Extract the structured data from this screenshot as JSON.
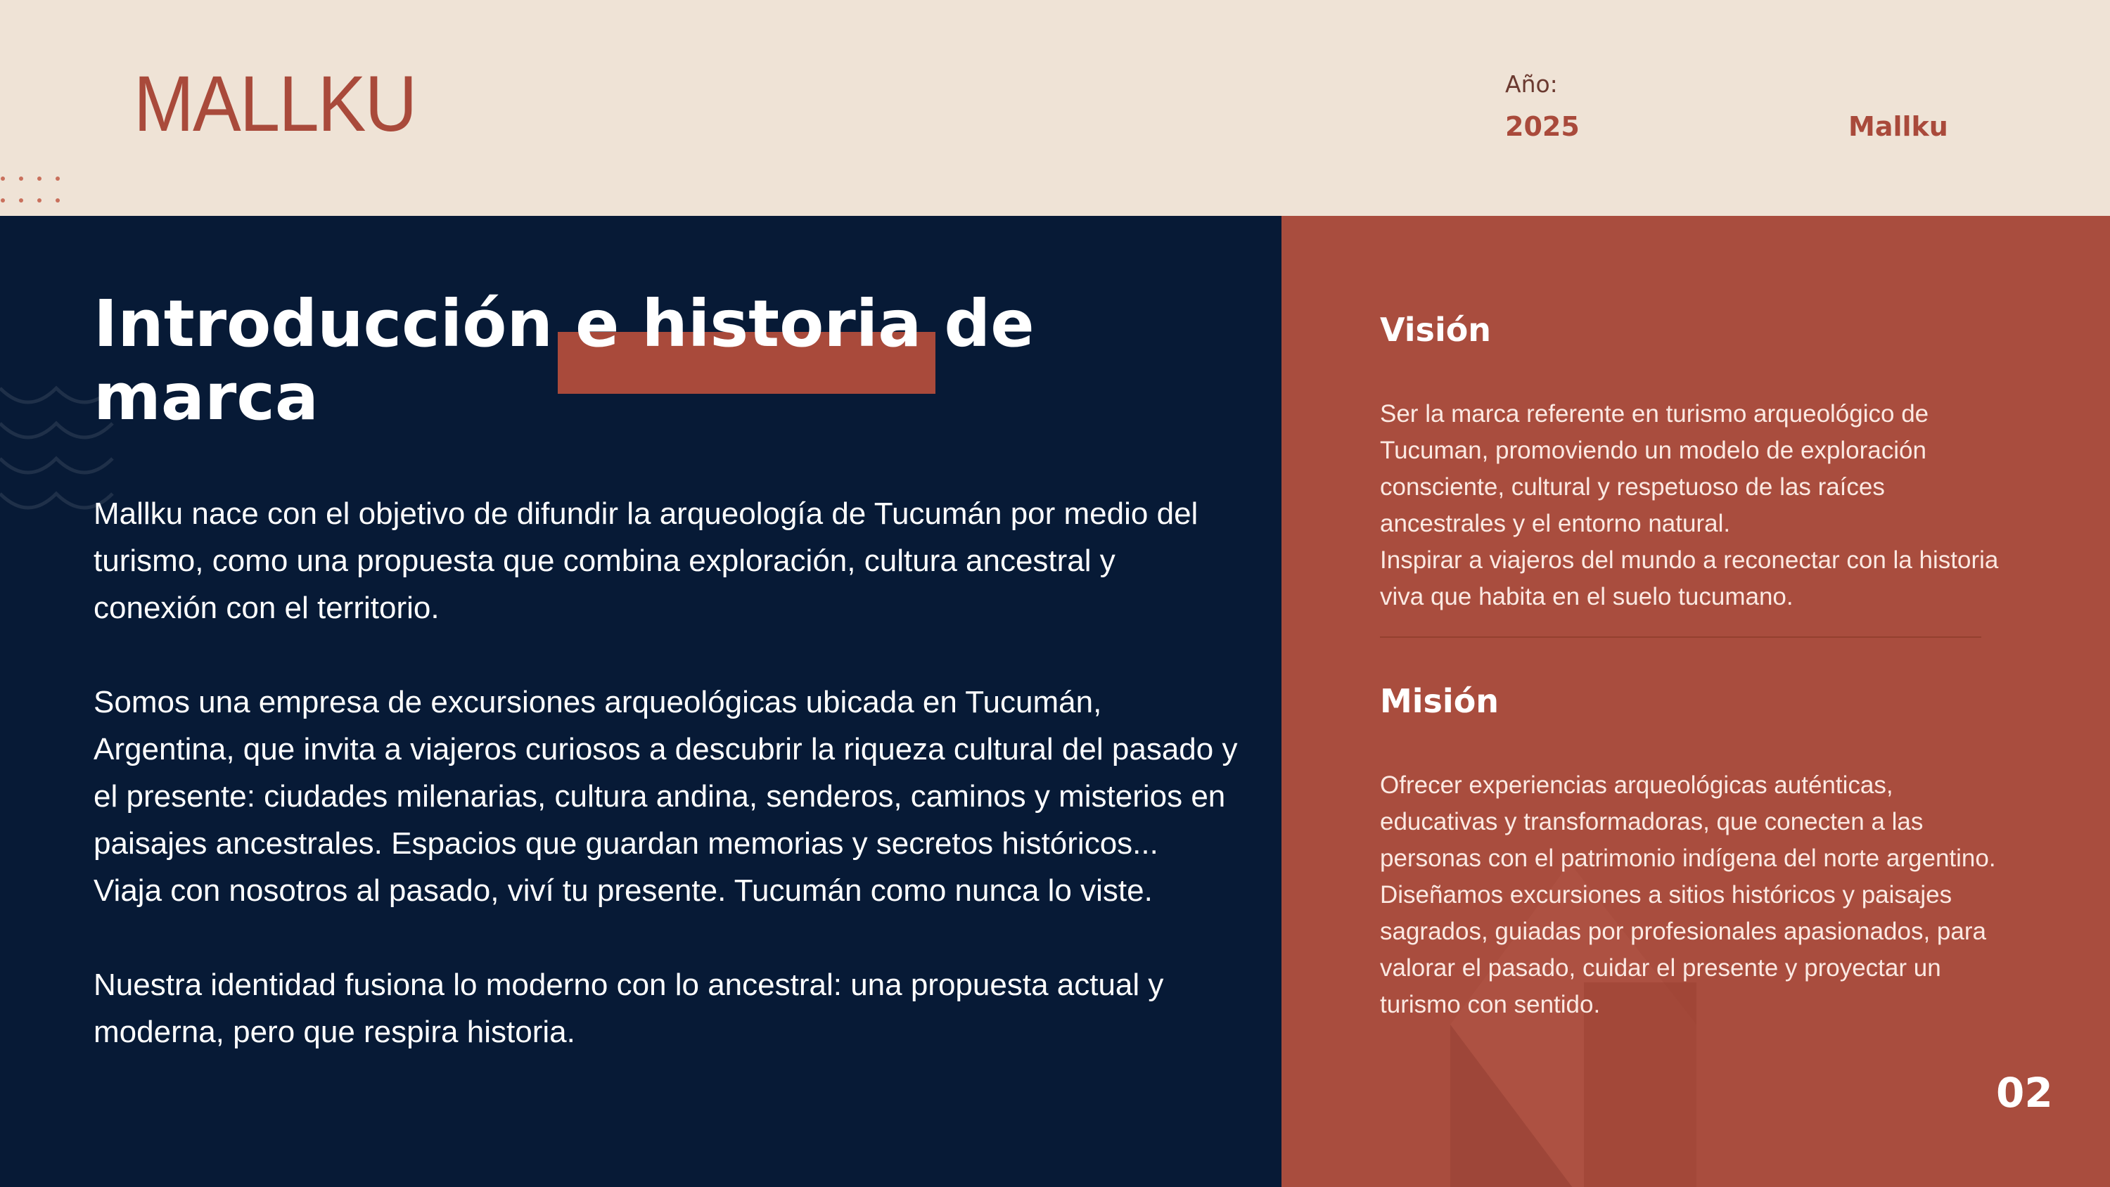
{
  "header": {
    "logo": "MALLKU",
    "year_label": "Año:",
    "year_value": "2025",
    "brand": "Mallku"
  },
  "intro": {
    "title": "Introducción e historia de marca",
    "paragraphs": [
      "Mallku nace con el objetivo de difundir la arqueología de Tucumán por medio del turismo, como una propuesta que combina exploración, cultura ancestral y conexión con el territorio.",
      "Somos una empresa de excursiones arqueológicas ubicada en Tucumán, Argentina, que invita a viajeros curiosos a descubrir la riqueza cultural del pasado y el presente: ciudades milenarias, cultura andina, senderos, caminos y misterios en paisajes ancestrales. Espacios que guardan memorias y secretos históricos...",
      "Viaja con nosotros al pasado, viví tu presente. Tucumán como nunca lo viste.",
      "Nuestra identidad fusiona lo moderno con lo ancestral: una propuesta actual y moderna, pero que respira historia."
    ]
  },
  "vision": {
    "title": "Visión",
    "paragraphs": [
      "Ser la marca referente en turismo arqueológico de Tucuman, promoviendo un modelo de exploración consciente, cultural y respetuoso de las raíces ancestrales y el entorno natural.",
      "Inspirar a viajeros del mundo a reconectar con la historia viva que habita en  el suelo tucumano."
    ]
  },
  "mission": {
    "title": "Misión",
    "paragraphs": [
      "Ofrecer experiencias arqueológicas auténticas, educativas y transformadoras, que conecten a las personas con el patrimonio indígena del norte argentino.",
      "Diseñamos excursiones a sitios históricos y paisajes sagrados, guiadas por profesionales apasionados, para valorar el pasado, cuidar el presente y proyectar un turismo con sentido."
    ]
  },
  "page_number": "02",
  "colors": {
    "cream": "#efe3d6",
    "navy": "#071a36",
    "terracotta": "#a94d3e"
  }
}
